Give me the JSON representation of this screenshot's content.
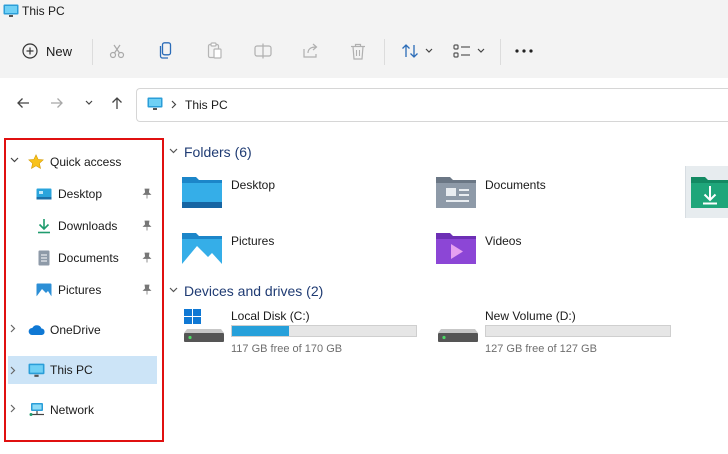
{
  "window": {
    "title": "This PC"
  },
  "toolbar": {
    "new_label": "New",
    "icons": [
      "cut-icon",
      "copy-icon",
      "paste-icon",
      "rename-icon",
      "share-icon",
      "delete-icon",
      "sort-icon",
      "view-icon",
      "more-icon"
    ]
  },
  "address": {
    "crumb": "This PC"
  },
  "sidebar": {
    "items": [
      {
        "label": "Quick access",
        "icon": "star-icon"
      },
      {
        "label": "Desktop",
        "icon": "desktop-folder-icon",
        "pinned": true
      },
      {
        "label": "Downloads",
        "icon": "download-icon",
        "pinned": true
      },
      {
        "label": "Documents",
        "icon": "document-icon",
        "pinned": true
      },
      {
        "label": "Pictures",
        "icon": "pictures-icon",
        "pinned": true
      },
      {
        "label": "OneDrive",
        "icon": "cloud-icon"
      },
      {
        "label": "This PC",
        "icon": "computer-icon",
        "selected": true
      },
      {
        "label": "Network",
        "icon": "network-icon"
      }
    ]
  },
  "folders": {
    "header": "Folders (6)",
    "items": [
      {
        "label": "Desktop",
        "icon": "desktop-folder-icon"
      },
      {
        "label": "Documents",
        "icon": "documents-folder-icon"
      },
      {
        "label": "Pictures",
        "icon": "pictures-folder-icon"
      },
      {
        "label": "Videos",
        "icon": "videos-folder-icon"
      }
    ]
  },
  "drives": {
    "header": "Devices and drives (2)",
    "items": [
      {
        "name": "Local Disk (C:)",
        "free": "117 GB free of 170 GB",
        "used_fraction": 0.31
      },
      {
        "name": "New Volume (D:)",
        "free": "127 GB free of 127 GB",
        "used_fraction": 0.0
      }
    ]
  },
  "colors": {
    "accent": "#26a0da",
    "highlight": "#cce4f7",
    "callout_border": "#e01010",
    "section_header": "#1f3b73"
  }
}
